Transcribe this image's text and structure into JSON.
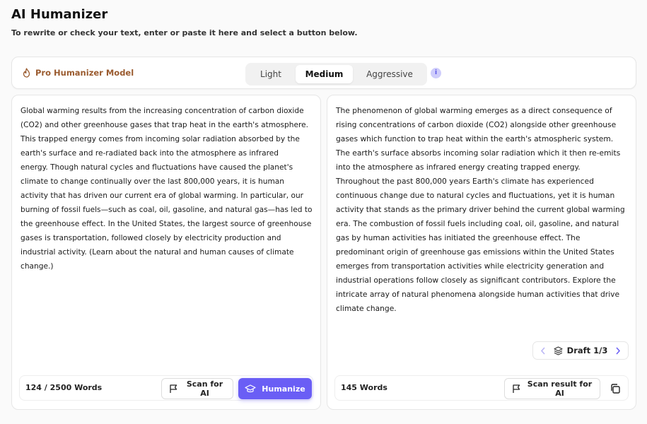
{
  "header": {
    "title": "AI Humanizer",
    "subtitle": "To rewrite or check your text, enter or paste it here and select a button below."
  },
  "toolbar": {
    "model_label": "Pro Humanizer Model",
    "modes": [
      "Light",
      "Medium",
      "Aggressive"
    ],
    "selected_mode": "Medium",
    "info_glyph": "i"
  },
  "input_panel": {
    "text": "Global warming results from the increasing concentration of carbon dioxide\n(CO2) and other greenhouse gases that trap heat in the earth's atmosphere.\nThis trapped energy comes from incoming solar radiation absorbed by the\nearth's surface and re-radiated back into the atmosphere as infrared\nenergy. Though natural cycles and fluctuations have caused the planet's\nclimate to change continually over the last 800,000 years, it is human\nactivity that has driven our current era of global warming. In particular, our\nburning of fossil fuels—such as coal, oil, gasoline, and natural gas—has led to\nthe greenhouse effect. In the United States, the largest source of greenhouse\ngases is transportation, followed closely by electricity production and\nindustrial activity. (Learn about the natural and human causes of climate\nchange.)",
    "word_count": "124 / 2500 Words",
    "scan_label": "Scan for AI",
    "humanize_label": "Humanize"
  },
  "output_panel": {
    "text": "The phenomenon of global warming emerges as a direct consequence of\nrising concentrations of carbon dioxide (CO2) alongside other greenhouse\ngases which function to trap heat within the earth's atmospheric system.\nThe earth's surface absorbs incoming solar radiation which it then re-emits\ninto the atmosphere as infrared energy creating trapped energy.\nThroughout the past 800,000 years Earth's climate has experienced\ncontinuous change due to natural cycles and fluctuations, yet it is human\nactivity that stands as the primary driver behind the current global warming\nera. The combustion of fossil fuels including coal, oil, gasoline, and natural\ngas by human activities has initiated the greenhouse effect. The\npredominant origin of greenhouse gas emissions within the United States\nemerges from transportation activities while electricity generation and\nindustrial operations follow closely as significant contributors. Explore the\nintricate array of natural phenomena alongside human activities that drive\nclimate change.",
    "draft_label": "Draft 1/3",
    "word_count": "145 Words",
    "scan_label": "Scan result for AI"
  },
  "icons": {
    "flame": "flame-icon",
    "info": "info-icon",
    "flag": "flag-icon",
    "graduation_cap": "graduation-cap-icon",
    "layers": "layers-icon",
    "chevron_left": "chevron-left-icon",
    "chevron_right": "chevron-right-icon",
    "copy": "copy-icon"
  },
  "colors": {
    "accent": "#6a5ef5",
    "model_label": "#9a5b2f"
  }
}
